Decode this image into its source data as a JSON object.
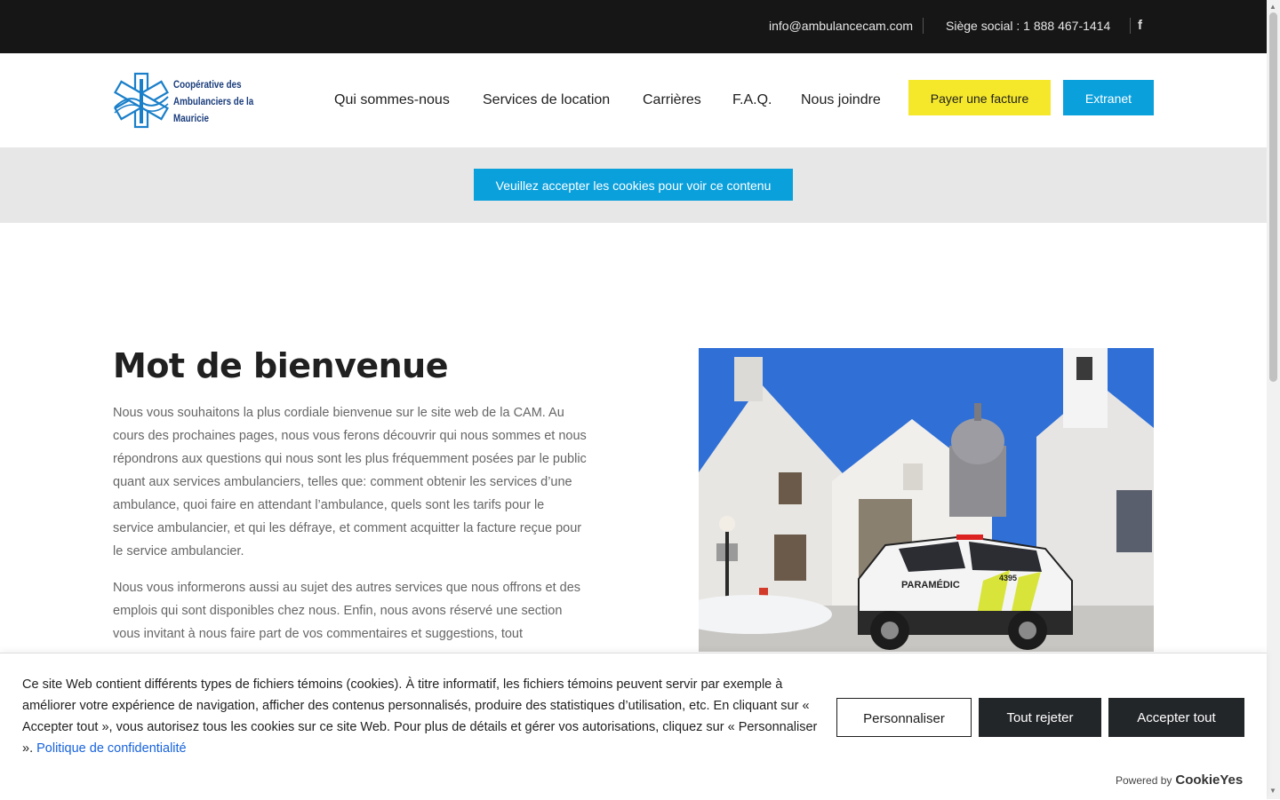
{
  "topbar": {
    "email": "info@ambulancecam.com",
    "phone": "Siège social : 1 888 467-1414",
    "facebook_icon": "f"
  },
  "logo": {
    "line1": "Coopérative des",
    "line2": "Ambulanciers de la",
    "line3": "Mauricie"
  },
  "nav": {
    "items": [
      "Qui sommes-nous",
      "Services de location",
      "Carrières",
      "F.A.Q.",
      "Nous joindre"
    ],
    "pay_label": "Payer une facture",
    "extranet_label": "Extranet"
  },
  "cookie_placeholder": {
    "label": "Veuillez accepter les cookies pour voir ce contenu"
  },
  "welcome": {
    "title": "Mot de bienvenue",
    "p1": "Nous vous souhaitons la plus cordiale bienvenue sur le site web de la CAM. Au cours des prochaines pages, nous vous ferons découvrir qui nous sommes et nous répondrons aux questions qui nous sont les plus fréquemment posées par le public quant aux services ambulanciers, telles que: comment obtenir les services d’une ambulance, quoi faire en attendant l’ambulance, quels sont les tarifs pour le service ambulancier, et qui les défraye, et comment acquitter la facture reçue pour le service ambulancier.",
    "p2": "Nous vous informerons aussi au sujet des autres services que nous offrons et des emplois qui sont disponibles chez nous. Enfin, nous avons réservé une section vous invitant à nous faire part de vos commentaires et suggestions, tout"
  },
  "photo": {
    "vehicle_label": "PARAMÉDIC",
    "vehicle_number": "4395"
  },
  "cookie_banner": {
    "text": "Ce site Web contient différents types de fichiers témoins (cookies). À titre informatif, les fichiers témoins peuvent servir par exemple à améliorer votre expérience de navigation, afficher des contenus personnalisés, produire des statistiques d’utilisation, etc. En cliquant sur « Accepter tout », vous autorisez tous les cookies sur ce site Web. Pour plus de détails et gérer vos autorisations, cliquez sur « Personnaliser ». ",
    "link": "Politique de confidentialité",
    "customize": "Personnaliser",
    "reject": "Tout rejeter",
    "accept": "Accepter tout",
    "powered_by": "Powered by",
    "brand": "CookieYes"
  },
  "colors": {
    "topbar_bg": "#161616",
    "pay_button": "#f5e82b",
    "accent_blue": "#0aa0dc",
    "dark_button": "#232629",
    "link_blue": "#1863dc"
  }
}
